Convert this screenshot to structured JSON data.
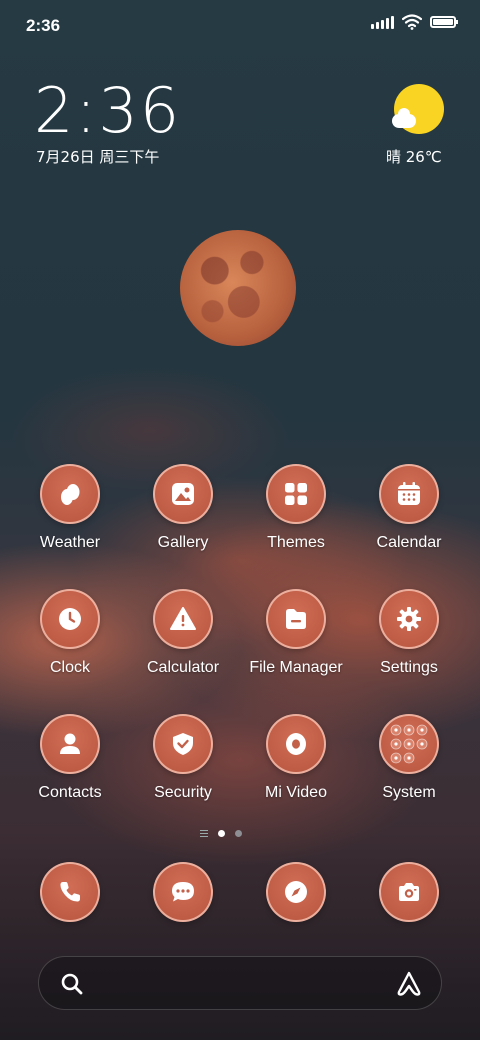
{
  "status_bar": {
    "time": "2:36"
  },
  "clock_widget": {
    "time": "2:36",
    "date": "7月26日 周三下午"
  },
  "weather_widget": {
    "text": "晴 26℃",
    "sun_color": "#f9d423"
  },
  "apps": [
    {
      "label": "Weather",
      "icon": "weather-icon"
    },
    {
      "label": "Gallery",
      "icon": "gallery-icon"
    },
    {
      "label": "Themes",
      "icon": "themes-icon"
    },
    {
      "label": "Calendar",
      "icon": "calendar-icon"
    },
    {
      "label": "Clock",
      "icon": "clock-icon"
    },
    {
      "label": "Calculator",
      "icon": "calculator-icon"
    },
    {
      "label": "File Manager",
      "icon": "file-manager-icon"
    },
    {
      "label": "Settings",
      "icon": "gear-icon"
    },
    {
      "label": "Contacts",
      "icon": "contacts-icon"
    },
    {
      "label": "Security",
      "icon": "shield-icon"
    },
    {
      "label": "Mi Video",
      "icon": "video-icon"
    },
    {
      "label": "System",
      "icon": "folder-icon"
    }
  ],
  "page_indicator": {
    "pages": 2,
    "current": 1
  },
  "dock": [
    {
      "icon": "phone-icon"
    },
    {
      "icon": "messages-icon"
    },
    {
      "icon": "browser-icon"
    },
    {
      "icon": "camera-icon"
    }
  ],
  "colors": {
    "icon_accent": "#c2604a",
    "icon_glyph": "#ffffff"
  }
}
